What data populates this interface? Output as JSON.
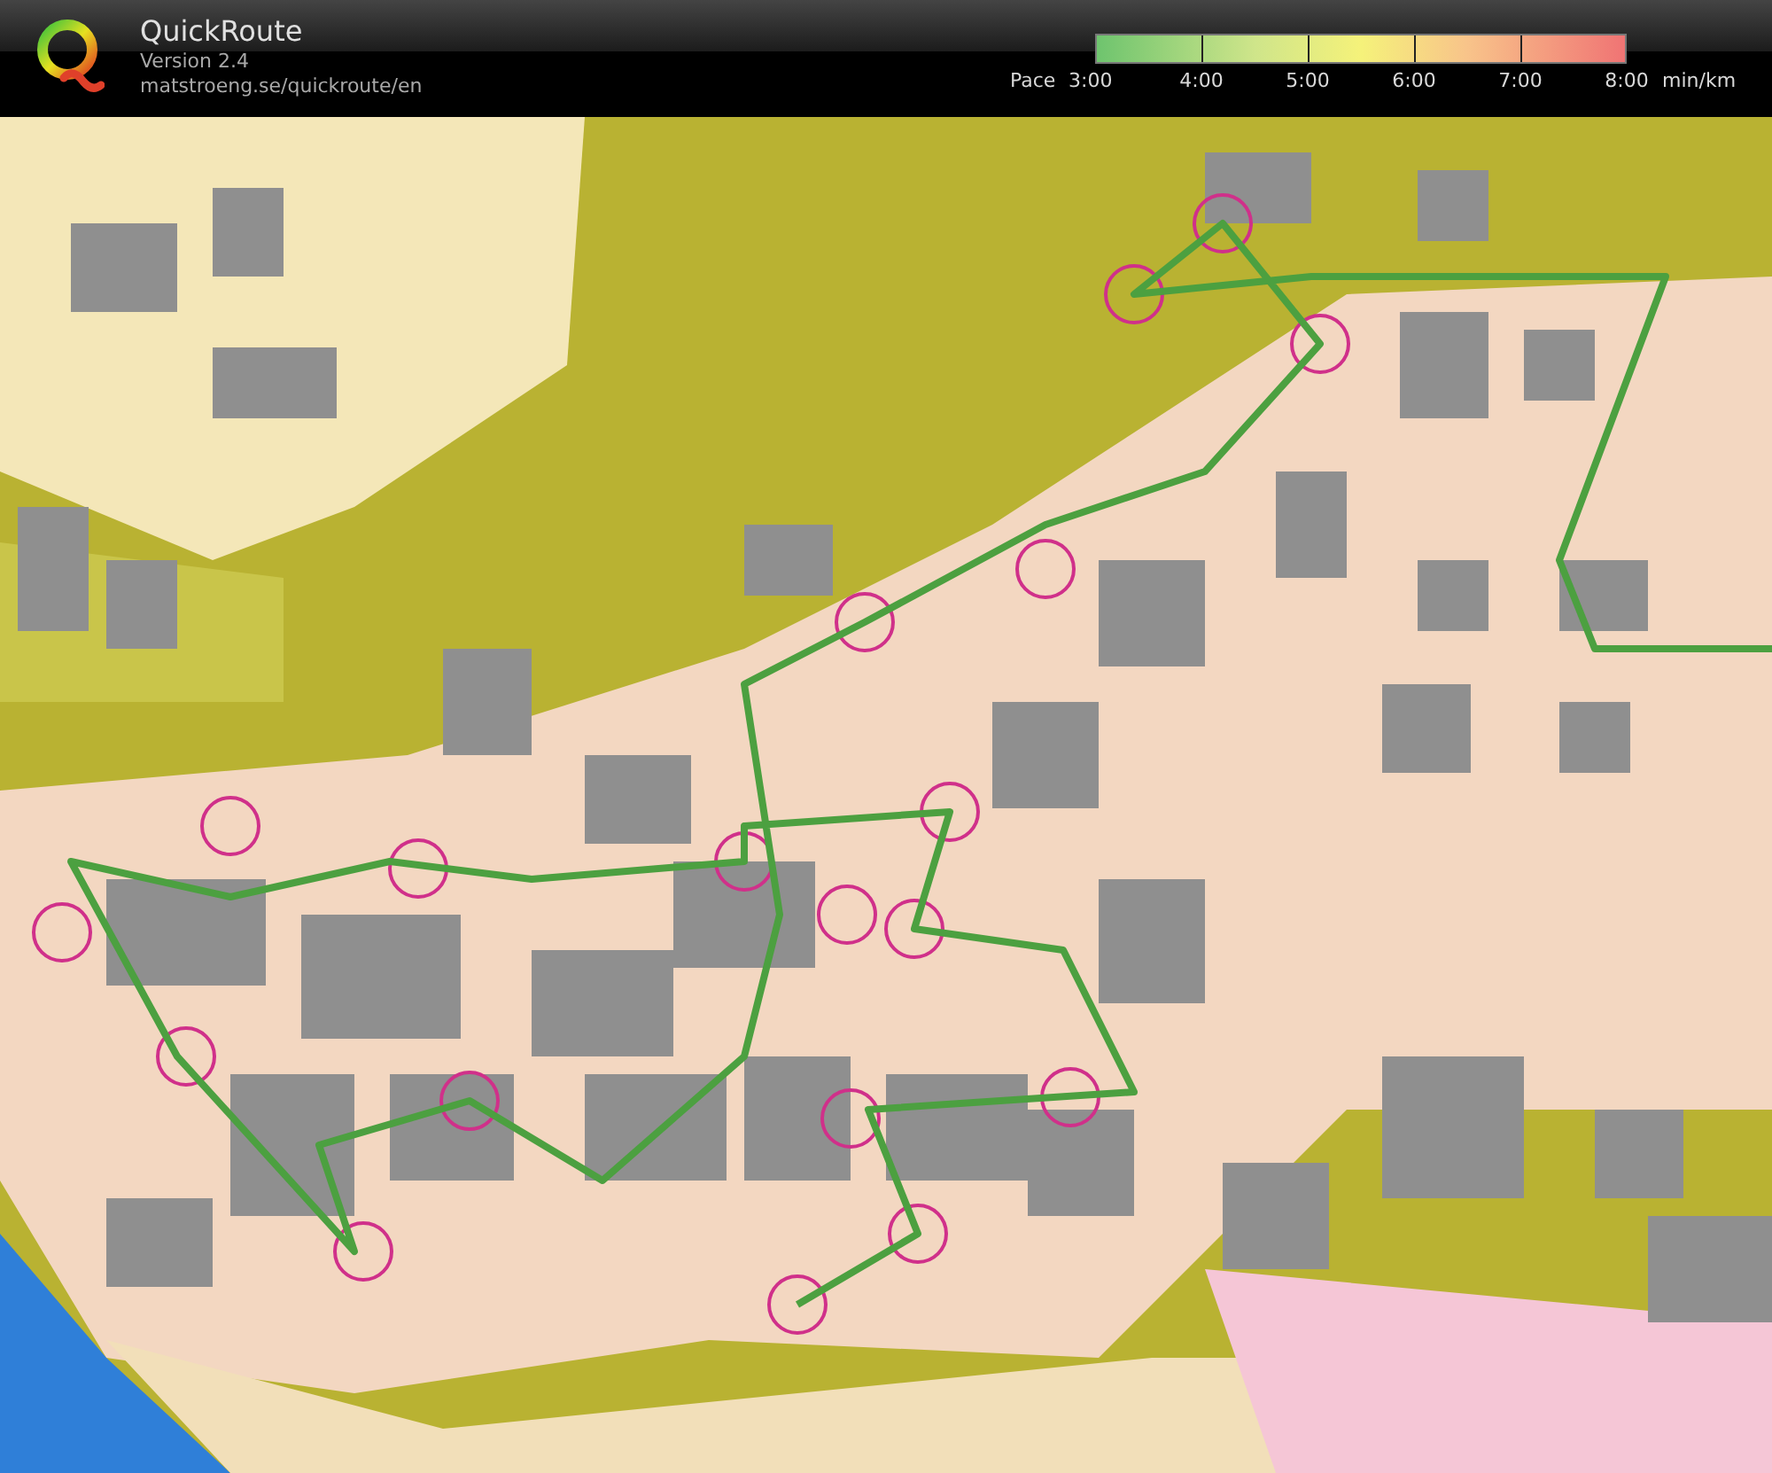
{
  "app": {
    "name": "QuickRoute",
    "version": "Version 2.4",
    "url": "matstroeng.se/quickroute/en"
  },
  "pace_legend": {
    "label": "Pace",
    "ticks": [
      "3:00",
      "4:00",
      "5:00",
      "6:00",
      "7:00",
      "8:00"
    ],
    "unit": "min/km"
  }
}
